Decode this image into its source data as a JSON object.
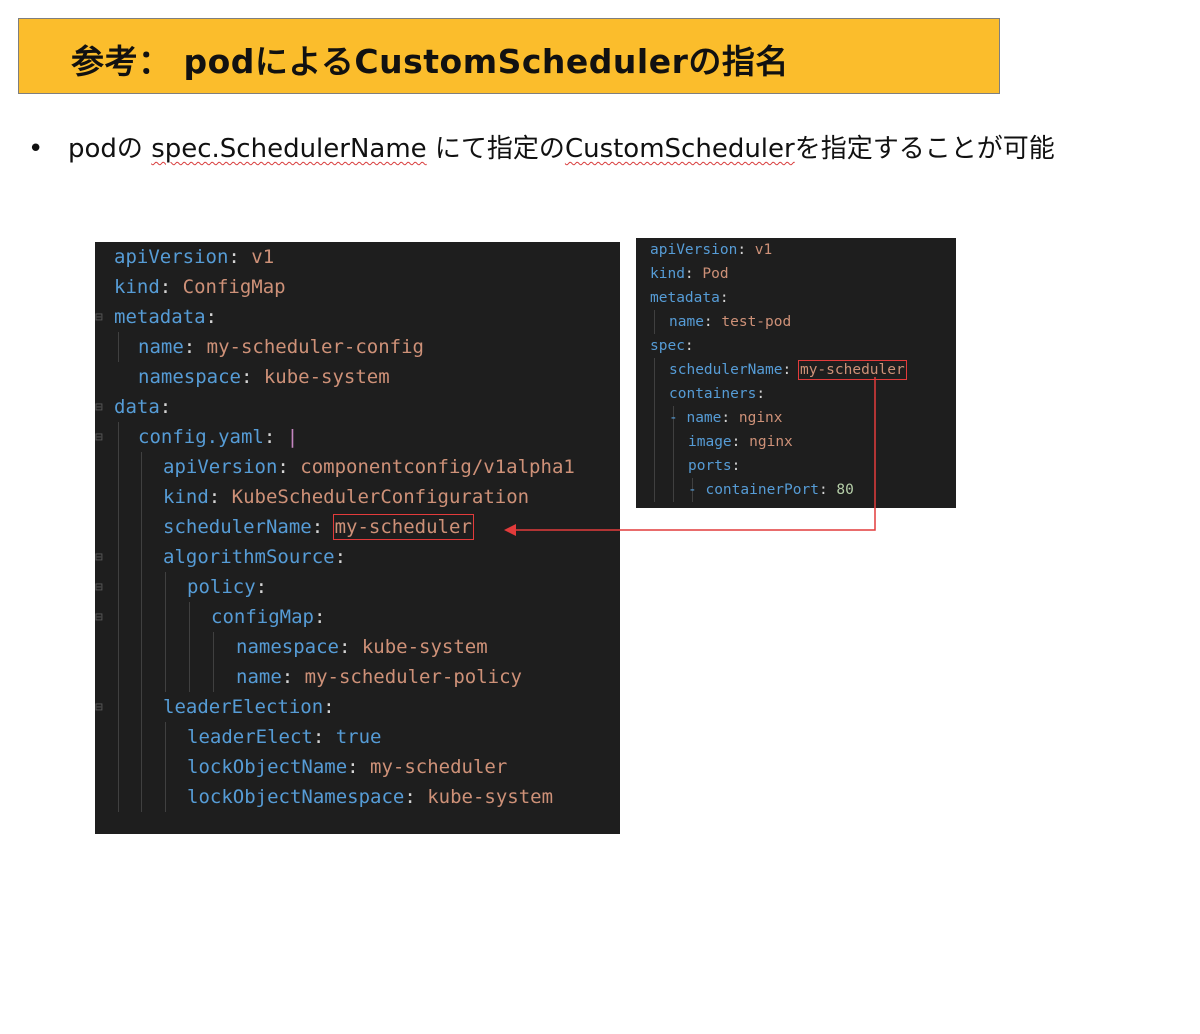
{
  "title": "参考： podによるCustomSchedulerの指名",
  "bullet": {
    "marker": "•",
    "text_prefix": "podの ",
    "term1": "spec.SchedulerName",
    "text_middle": " にて指定の",
    "term2": "CustomScheduler",
    "text_suffix": "を指定することが可能"
  },
  "configmap_yaml": {
    "lines": [
      {
        "key": "apiVersion",
        "sep": ": ",
        "value": "v1"
      },
      {
        "key": "kind",
        "sep": ": ",
        "value": "ConfigMap"
      },
      {
        "key": "metadata",
        "sep": ":",
        "value": ""
      },
      {
        "key": "name",
        "sep": ": ",
        "value": "my-scheduler-config"
      },
      {
        "key": "namespace",
        "sep": ": ",
        "value": "kube-system"
      },
      {
        "key": "data",
        "sep": ":",
        "value": ""
      },
      {
        "key": "config.yaml",
        "sep": ": ",
        "value": "|"
      },
      {
        "key": "apiVersion",
        "sep": ": ",
        "value": "componentconfig/v1alpha1"
      },
      {
        "key": "kind",
        "sep": ": ",
        "value": "KubeSchedulerConfiguration"
      },
      {
        "key": "schedulerName",
        "sep": ": ",
        "value": "my-scheduler"
      },
      {
        "key": "algorithmSource",
        "sep": ":",
        "value": ""
      },
      {
        "key": "policy",
        "sep": ":",
        "value": ""
      },
      {
        "key": "configMap",
        "sep": ":",
        "value": ""
      },
      {
        "key": "namespace",
        "sep": ": ",
        "value": "kube-system"
      },
      {
        "key": "name",
        "sep": ": ",
        "value": "my-scheduler-policy"
      },
      {
        "key": "leaderElection",
        "sep": ":",
        "value": ""
      },
      {
        "key": "leaderElect",
        "sep": ": ",
        "value": "true"
      },
      {
        "key": "lockObjectName",
        "sep": ": ",
        "value": "my-scheduler"
      },
      {
        "key": "lockObjectNamespace",
        "sep": ": ",
        "value": "kube-system"
      }
    ]
  },
  "pod_yaml": {
    "lines": [
      {
        "key": "apiVersion",
        "sep": ": ",
        "value": "v1"
      },
      {
        "key": "kind",
        "sep": ": ",
        "value": "Pod"
      },
      {
        "key": "metadata",
        "sep": ":",
        "value": ""
      },
      {
        "key": "name",
        "sep": ": ",
        "value": "test-pod"
      },
      {
        "key": "spec",
        "sep": ":",
        "value": ""
      },
      {
        "key": "schedulerName",
        "sep": ": ",
        "value": "my-scheduler"
      },
      {
        "key": "containers",
        "sep": ":",
        "value": ""
      },
      {
        "key": "- name",
        "sep": ": ",
        "value": "nginx"
      },
      {
        "key": "image",
        "sep": ": ",
        "value": "nginx"
      },
      {
        "key": "ports",
        "sep": ":",
        "value": ""
      },
      {
        "key": "- containerPort",
        "sep": ": ",
        "value": "80"
      }
    ]
  },
  "colors": {
    "title_background": "#fbbd2c",
    "editor_background": "#1e1e1e",
    "yaml_key": "#569cd6",
    "yaml_string": "#ce9178",
    "yaml_number": "#b5cea8",
    "highlight_and_arrow": "#e23b3b"
  }
}
